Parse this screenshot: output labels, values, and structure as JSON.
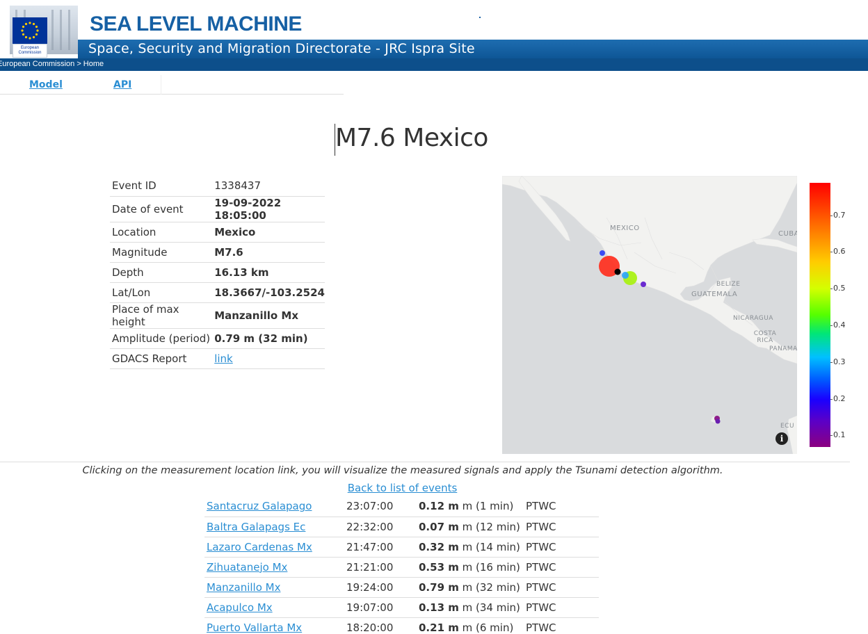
{
  "header": {
    "logo_caption": "European Commission",
    "site_title": "SEA LEVEL MACHINE",
    "subtitle": "Space, Security and Migration Directorate - JRC Ispra Site",
    "breadcrumb": "European Commission  > Home",
    "brand_color": "#1660a4"
  },
  "nav": {
    "items": [
      {
        "label": "Model"
      },
      {
        "label": "API"
      }
    ]
  },
  "event": {
    "title": "M7.6 Mexico",
    "fields": [
      {
        "label": "Event ID",
        "value": "1338437"
      },
      {
        "label": "Date of event",
        "value": "19-09-2022 18:05:00"
      },
      {
        "label": "Location",
        "value": "Mexico"
      },
      {
        "label": "Magnitude",
        "value": "M7.6"
      },
      {
        "label": "Depth",
        "value": "16.13 km"
      },
      {
        "label": "Lat/Lon",
        "value": "18.3667/-103.2524"
      },
      {
        "label": "Place of max height",
        "value": "Manzanillo Mx"
      },
      {
        "label": "Amplitude (period)",
        "value": "0.79 m (32 min)"
      },
      {
        "label": "GDACS Report",
        "value": "link"
      }
    ]
  },
  "map": {
    "labels": {
      "mexico": "MEXICO",
      "cuba": "CUBA",
      "belize": "BELIZE",
      "guatemala": "GUATEMALA",
      "nicaragua": "NICARAGUA",
      "costa_rica": "COSTA RICA",
      "panama": "PANAMA",
      "ecuador": "ECU"
    },
    "info_icon": "i",
    "colorbar_ticks": [
      "0.7",
      "0.6",
      "0.5",
      "0.4",
      "0.3",
      "0.2",
      "0.1"
    ]
  },
  "measurements": {
    "note": "Clicking on the measurement location link, you will visualize the measured signals and apply the Tsunami detection algorithm.",
    "back_link": "Back to list of events",
    "rows": [
      {
        "location": "Santacruz Galapago",
        "time": "23:07:00",
        "amp": "0.12 m",
        "detail": " m (1 min)",
        "source": "PTWC"
      },
      {
        "location": "Baltra Galapags Ec",
        "time": "22:32:00",
        "amp": "0.07 m",
        "detail": " m (12 min)",
        "source": "PTWC"
      },
      {
        "location": "Lazaro Cardenas Mx",
        "time": "21:47:00",
        "amp": "0.32 m",
        "detail": " m (14 min)",
        "source": "PTWC"
      },
      {
        "location": "Zihuatanejo Mx",
        "time": "21:21:00",
        "amp": "0.53 m",
        "detail": " m (16 min)",
        "source": "PTWC"
      },
      {
        "location": "Manzanillo Mx",
        "time": "19:24:00",
        "amp": "0.79 m",
        "detail": " m (32 min)",
        "source": "PTWC"
      },
      {
        "location": "Acapulco Mx",
        "time": "19:07:00",
        "amp": "0.13 m",
        "detail": " m (34 min)",
        "source": "PTWC"
      },
      {
        "location": "Puerto Vallarta Mx",
        "time": "18:20:00",
        "amp": "0.21 m",
        "detail": " m (6 min)",
        "source": "PTWC"
      }
    ]
  }
}
